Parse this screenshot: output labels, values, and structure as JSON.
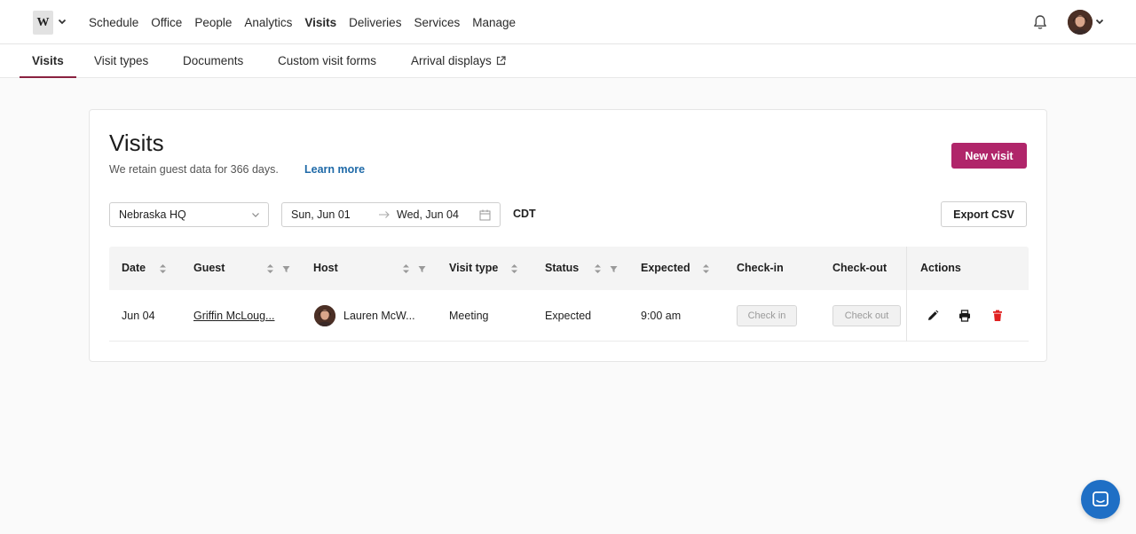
{
  "nav": {
    "logo_letter": "W",
    "items": [
      {
        "label": "Schedule",
        "active": false
      },
      {
        "label": "Office",
        "active": false
      },
      {
        "label": "People",
        "active": false
      },
      {
        "label": "Analytics",
        "active": false
      },
      {
        "label": "Visits",
        "active": true
      },
      {
        "label": "Deliveries",
        "active": false
      },
      {
        "label": "Services",
        "active": false
      },
      {
        "label": "Manage",
        "active": false
      }
    ]
  },
  "subnav": {
    "tabs": [
      {
        "label": "Visits",
        "active": true
      },
      {
        "label": "Visit types",
        "active": false
      },
      {
        "label": "Documents",
        "active": false
      },
      {
        "label": "Custom visit forms",
        "active": false
      },
      {
        "label": "Arrival displays",
        "active": false,
        "external": true
      }
    ]
  },
  "page": {
    "title": "Visits",
    "retention_text": "We retain guest data for 366 days.",
    "learn_more": "Learn more",
    "new_visit_label": "New visit",
    "export_label": "Export CSV"
  },
  "filters": {
    "location": "Nebraska HQ",
    "date_start": "Sun, Jun 01",
    "date_end": "Wed, Jun 04",
    "timezone": "CDT"
  },
  "table": {
    "columns": {
      "date": "Date",
      "guest": "Guest",
      "host": "Host",
      "visit_type": "Visit type",
      "status": "Status",
      "expected": "Expected",
      "check_in": "Check-in",
      "check_out": "Check-out",
      "actions": "Actions"
    },
    "rows": [
      {
        "date": "Jun 04",
        "guest": "Griffin McLoug...",
        "host": "Lauren McW...",
        "visit_type": "Meeting",
        "status": "Expected",
        "expected": "9:00 am",
        "check_in_label": "Check in",
        "check_out_label": "Check out"
      }
    ]
  },
  "icons": {
    "bell": "bell-icon",
    "external": "external-link-icon",
    "calendar": "calendar-icon",
    "edit": "pencil-icon",
    "print": "printer-icon",
    "delete": "trash-icon",
    "chat": "chat-icon"
  },
  "colors": {
    "accent": "#b0256a",
    "tab_underline": "#8a2240",
    "link": "#1f6aa8",
    "delete": "#e02020",
    "chat": "#1f6fc5"
  }
}
